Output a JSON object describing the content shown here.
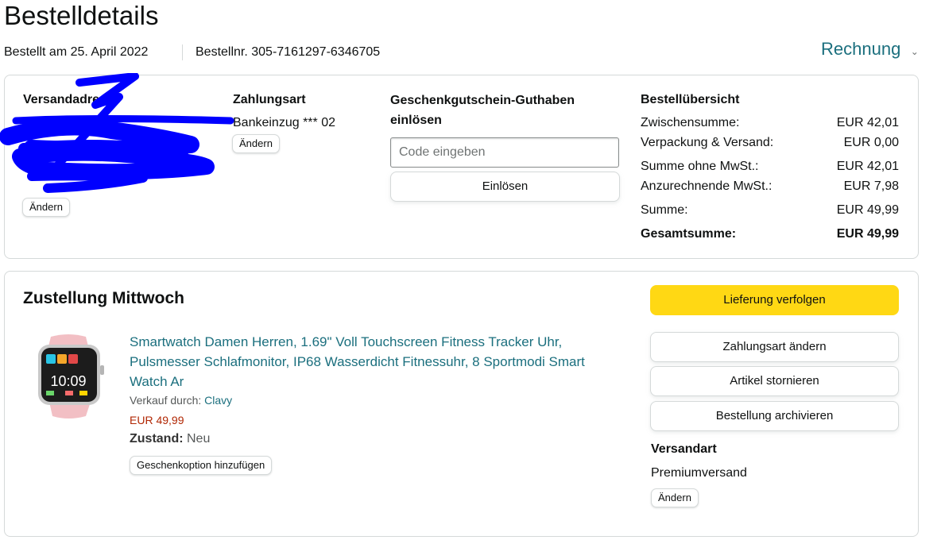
{
  "page": {
    "title": "Bestelldetails",
    "ordered_on": "Bestellt am 25. April 2022",
    "order_number": "Bestellnr. 305-7161297-6346705",
    "invoice_label": "Rechnung"
  },
  "shipping_address": {
    "heading": "Versandadresse",
    "change_label": "Ändern"
  },
  "payment": {
    "heading": "Zahlungsart",
    "method": "Bankeinzug *** 02",
    "change_label": "Ändern"
  },
  "gift_card": {
    "heading": "Geschenkgutschein-Guthaben einlösen",
    "placeholder": "Code eingeben",
    "redeem_label": "Einlösen"
  },
  "summary": {
    "heading": "Bestellübersicht",
    "rows": [
      {
        "label": "Zwischensumme:",
        "value": "EUR 42,01"
      },
      {
        "label": "Verpackung & Versand:",
        "value": "EUR 0,00"
      },
      {
        "label": "Summe ohne MwSt.:",
        "value": "EUR 42,01"
      },
      {
        "label": "Anzurechnende MwSt.:",
        "value": "EUR 7,98"
      },
      {
        "label": "Summe:",
        "value": "EUR 49,99"
      }
    ],
    "total_label": "Gesamtsumme:",
    "total_value": "EUR 49,99"
  },
  "delivery": {
    "heading": "Zustellung Mittwoch",
    "product_title": "Smartwatch Damen Herren, 1.69\" Voll Touchscreen Fitness Tracker Uhr, Pulsmesser Schlafmonitor, IP68 Wasserdicht Fitnessuhr, 8 Sportmodi Smart Watch Ar",
    "sold_by_label": "Verkauf durch:",
    "seller": "Clavy",
    "price": "EUR 49,99",
    "condition_label": "Zustand:",
    "condition": "Neu",
    "gift_option_label": "Geschenkoption hinzufügen",
    "watch_time": "10:09",
    "track_label": "Lieferung verfolgen",
    "change_payment_label": "Zahlungsart ändern",
    "cancel_label": "Artikel stornieren",
    "archive_label": "Bestellung archivieren",
    "shipping_type_heading": "Versandart",
    "shipping_type": "Premiumversand",
    "change_label": "Ändern"
  },
  "colors": {
    "link": "#1b6f7e",
    "price": "#b12704",
    "primary_button": "#ffd814",
    "scribble": "#0000ff"
  }
}
